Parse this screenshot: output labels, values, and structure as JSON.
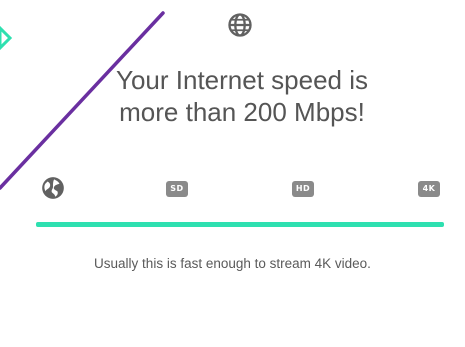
{
  "header": {
    "icon": "globe-icon"
  },
  "headline": {
    "line1": "Your Internet speed is",
    "line2": "more than 200 Mbps!"
  },
  "tiers": {
    "web_icon": "globe-icon",
    "sd_label": "SD",
    "hd_label": "HD",
    "uhd_label": "4K"
  },
  "progress": {
    "fraction": 1.0
  },
  "caption": {
    "text": "Usually this is fast enough to stream 4K video."
  },
  "colors": {
    "accent": "#2ee0b0",
    "decor_line": "#6a2fa0",
    "text": "#555555",
    "badge": "#8a8a8a"
  }
}
